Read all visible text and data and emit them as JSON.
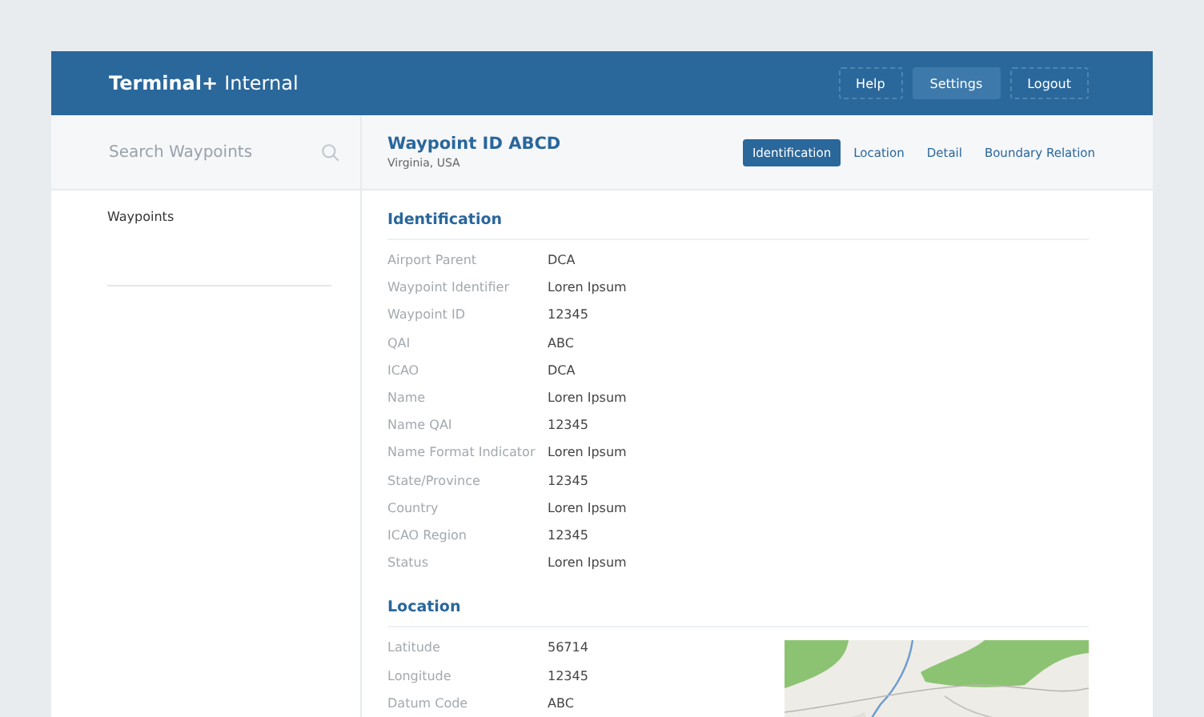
{
  "header": {
    "brand_bold": "Terminal+",
    "brand_light": "Internal",
    "buttons": [
      {
        "label": "Help",
        "selected": false
      },
      {
        "label": "Settings",
        "selected": true
      },
      {
        "label": "Logout",
        "selected": false
      }
    ]
  },
  "sidebar": {
    "search": {
      "placeholder": "Search Waypoints"
    },
    "items": [
      {
        "label": "Waypoints"
      }
    ]
  },
  "waypoint": {
    "title": "Waypoint ID ABCD",
    "subtitle": "Virginia, USA"
  },
  "tabs": [
    {
      "label": "Identification",
      "selected": true
    },
    {
      "label": "Location",
      "selected": false
    },
    {
      "label": "Detail",
      "selected": false
    },
    {
      "label": "Boundary Relation",
      "selected": false
    }
  ],
  "sections": [
    {
      "title": "Identification",
      "map": false,
      "fields": [
        {
          "label": "Airport Parent",
          "value": "DCA"
        },
        {
          "label": "Waypoint Identifier",
          "value": "Loren Ipsum"
        },
        {
          "label": "Waypoint ID",
          "value": "12345"
        },
        {
          "label": "QAI",
          "value": "ABC"
        },
        {
          "label": "ICAO",
          "value": "DCA"
        },
        {
          "label": "Name",
          "value": "Loren Ipsum"
        },
        {
          "label": "Name QAI",
          "value": "12345"
        },
        {
          "label": "Name Format Indicator",
          "value": "Loren Ipsum"
        },
        {
          "label": "State/Province",
          "value": "12345"
        },
        {
          "label": "Country",
          "value": "Loren Ipsum"
        },
        {
          "label": "ICAO Region",
          "value": "12345"
        },
        {
          "label": "Status",
          "value": "Loren Ipsum"
        }
      ]
    },
    {
      "title": "Location",
      "map": true,
      "fields": [
        {
          "label": "Latitude",
          "value": "56714"
        },
        {
          "label": "Longitude",
          "value": "12345"
        },
        {
          "label": "Datum Code",
          "value": "ABC"
        }
      ]
    }
  ]
}
